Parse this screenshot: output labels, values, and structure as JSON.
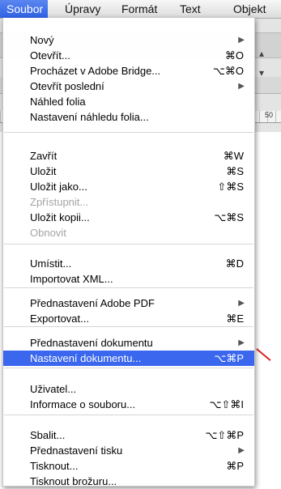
{
  "menubar": {
    "items": [
      "Soubor",
      "Úpravy",
      "Formát",
      "Text",
      "Objekt"
    ]
  },
  "ruler": {
    "label": "50"
  },
  "menu": {
    "items": [
      {
        "label": "Nový",
        "shortcut": "",
        "submenu": true,
        "disabled": false
      },
      {
        "label": "Otevřít...",
        "shortcut": "⌘O",
        "submenu": false,
        "disabled": false
      },
      {
        "label": "Procházet v Adobe Bridge...",
        "shortcut": "⌥⌘O",
        "submenu": false,
        "disabled": false
      },
      {
        "label": "Otevřít poslední",
        "shortcut": "",
        "submenu": true,
        "disabled": false
      },
      {
        "label": "Náhled folia",
        "shortcut": "",
        "submenu": false,
        "disabled": false
      },
      {
        "label": "Nastavení náhledu folia...",
        "shortcut": "",
        "submenu": false,
        "disabled": false
      },
      {
        "label": "Zavřít",
        "shortcut": "⌘W",
        "submenu": false,
        "disabled": false
      },
      {
        "label": "Uložit",
        "shortcut": "⌘S",
        "submenu": false,
        "disabled": false
      },
      {
        "label": "Uložit jako...",
        "shortcut": "⇧⌘S",
        "submenu": false,
        "disabled": false
      },
      {
        "label": "Zpřístupnit...",
        "shortcut": "",
        "submenu": false,
        "disabled": true
      },
      {
        "label": "Uložit kopii...",
        "shortcut": "⌥⌘S",
        "submenu": false,
        "disabled": false
      },
      {
        "label": "Obnovit",
        "shortcut": "",
        "submenu": false,
        "disabled": true
      },
      {
        "label": "Umístit...",
        "shortcut": "⌘D",
        "submenu": false,
        "disabled": false
      },
      {
        "label": "Importovat XML...",
        "shortcut": "",
        "submenu": false,
        "disabled": false
      },
      {
        "label": "Přednastavení Adobe PDF",
        "shortcut": "",
        "submenu": true,
        "disabled": false
      },
      {
        "label": "Exportovat...",
        "shortcut": "⌘E",
        "submenu": false,
        "disabled": false
      },
      {
        "label": "Přednastavení dokumentu",
        "shortcut": "",
        "submenu": true,
        "disabled": false
      },
      {
        "label": "Nastavení dokumentu...",
        "shortcut": "⌥⌘P",
        "submenu": false,
        "disabled": false,
        "highlighted": true
      },
      {
        "label": "Uživatel...",
        "shortcut": "",
        "submenu": false,
        "disabled": false
      },
      {
        "label": "Informace o souboru...",
        "shortcut": "⌥⇧⌘I",
        "submenu": false,
        "disabled": false
      },
      {
        "label": "Sbalit...",
        "shortcut": "⌥⇧⌘P",
        "submenu": false,
        "disabled": false
      },
      {
        "label": "Přednastavení tisku",
        "shortcut": "",
        "submenu": true,
        "disabled": false
      },
      {
        "label": "Tisknout...",
        "shortcut": "⌘P",
        "submenu": false,
        "disabled": false
      },
      {
        "label": "Tisknout brožuru...",
        "shortcut": "",
        "submenu": false,
        "disabled": false
      }
    ]
  },
  "colors": {
    "highlight": "#3a67ee",
    "disabled_text": "#a3a3a3"
  }
}
